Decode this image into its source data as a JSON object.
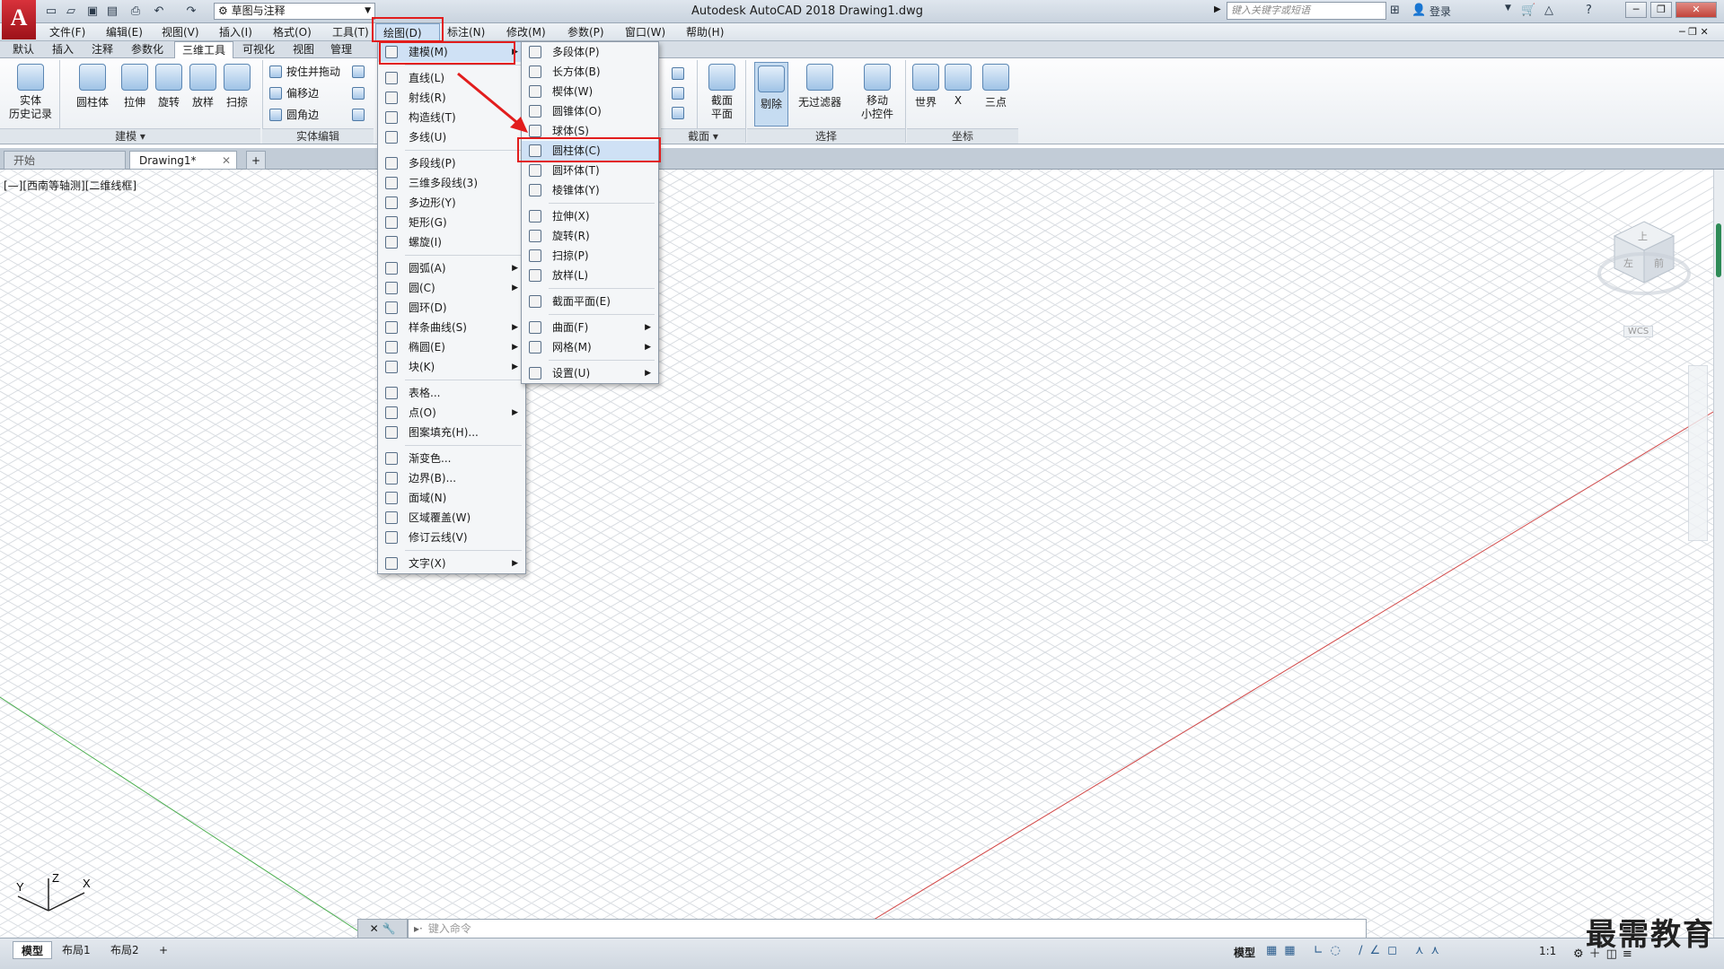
{
  "window": {
    "app_title": "Autodesk AutoCAD 2018    Drawing1.dwg",
    "workspace": "草图与注释",
    "search_placeholder": "键入关键字或短语",
    "login": "登录"
  },
  "menubar": [
    "文件(F)",
    "编辑(E)",
    "视图(V)",
    "插入(I)",
    "格式(O)",
    "工具(T)",
    "绘图(D)",
    "标注(N)",
    "修改(M)",
    "参数(P)",
    "窗口(W)",
    "帮助(H)"
  ],
  "ribbon_tabs": [
    "默认",
    "插入",
    "注释",
    "参数化",
    "三维工具",
    "可视化",
    "视图",
    "管理"
  ],
  "ribbon": {
    "history": "实体\n历史记录",
    "cylinder": "圆柱体",
    "extrude": "拉伸",
    "revolve": "旋转",
    "loft": "放样",
    "sweep": "扫掠",
    "presspull": "按住并拖动",
    "offset_edge": "偏移边",
    "fillet_edge": "圆角边",
    "group_model": "建模",
    "group_solid_edit": "实体编辑",
    "section_plane": "截面\n平面",
    "group_section": "截面",
    "cull": "剔除",
    "no_filter": "无过滤器",
    "move_gizmo": "移动\n小控件",
    "group_select": "选择",
    "world": "世界",
    "x": "X",
    "three_point": "三点",
    "group_coord": "坐标"
  },
  "doc_tabs": [
    "开始",
    "Drawing1*"
  ],
  "viewport_label": "[—][西南等轴测][二维线框]",
  "viewcube": {
    "top": "上",
    "left": "左",
    "front": "前",
    "wcs": "WCS"
  },
  "draw_menu": [
    {
      "label": "建模(M)",
      "arrow": true,
      "highlight": true
    },
    {
      "sep": true
    },
    {
      "label": "直线(L)"
    },
    {
      "label": "射线(R)"
    },
    {
      "label": "构造线(T)"
    },
    {
      "label": "多线(U)"
    },
    {
      "sep": true
    },
    {
      "label": "多段线(P)"
    },
    {
      "label": "三维多段线(3)"
    },
    {
      "label": "多边形(Y)"
    },
    {
      "label": "矩形(G)"
    },
    {
      "label": "螺旋(I)"
    },
    {
      "sep": true
    },
    {
      "label": "圆弧(A)",
      "arrow": true
    },
    {
      "label": "圆(C)",
      "arrow": true
    },
    {
      "label": "圆环(D)"
    },
    {
      "label": "样条曲线(S)",
      "arrow": true
    },
    {
      "label": "椭圆(E)",
      "arrow": true
    },
    {
      "label": "块(K)",
      "arrow": true
    },
    {
      "sep": true
    },
    {
      "label": "表格..."
    },
    {
      "label": "点(O)",
      "arrow": true
    },
    {
      "label": "图案填充(H)..."
    },
    {
      "sep": true
    },
    {
      "label": "渐变色..."
    },
    {
      "label": "边界(B)..."
    },
    {
      "label": "面域(N)"
    },
    {
      "label": "区域覆盖(W)"
    },
    {
      "label": "修订云线(V)"
    },
    {
      "sep": true
    },
    {
      "label": "文字(X)",
      "arrow": true
    }
  ],
  "model_submenu": [
    {
      "label": "多段体(P)"
    },
    {
      "label": "长方体(B)"
    },
    {
      "label": "楔体(W)"
    },
    {
      "label": "圆锥体(O)"
    },
    {
      "label": "球体(S)"
    },
    {
      "label": "圆柱体(C)",
      "highlight": true
    },
    {
      "label": "圆环体(T)"
    },
    {
      "label": "棱锥体(Y)"
    },
    {
      "sep": true
    },
    {
      "label": "拉伸(X)"
    },
    {
      "label": "旋转(R)"
    },
    {
      "label": "扫掠(P)"
    },
    {
      "label": "放样(L)"
    },
    {
      "sep": true
    },
    {
      "label": "截面平面(E)"
    },
    {
      "sep": true
    },
    {
      "label": "曲面(F)",
      "arrow": true
    },
    {
      "label": "网格(M)",
      "arrow": true
    },
    {
      "sep": true
    },
    {
      "label": "设置(U)",
      "arrow": true
    }
  ],
  "command_placeholder": "键入命令",
  "layout_tabs": [
    "模型",
    "布局1",
    "布局2"
  ],
  "status": {
    "model": "模型",
    "scale": "1:1"
  },
  "watermark": "最需教育",
  "colors": {
    "highlight_red": "#e21d1d",
    "menu_hover": "#cfe1f5",
    "x_axis": "#d24a4a",
    "y_axis": "#4caf50"
  }
}
